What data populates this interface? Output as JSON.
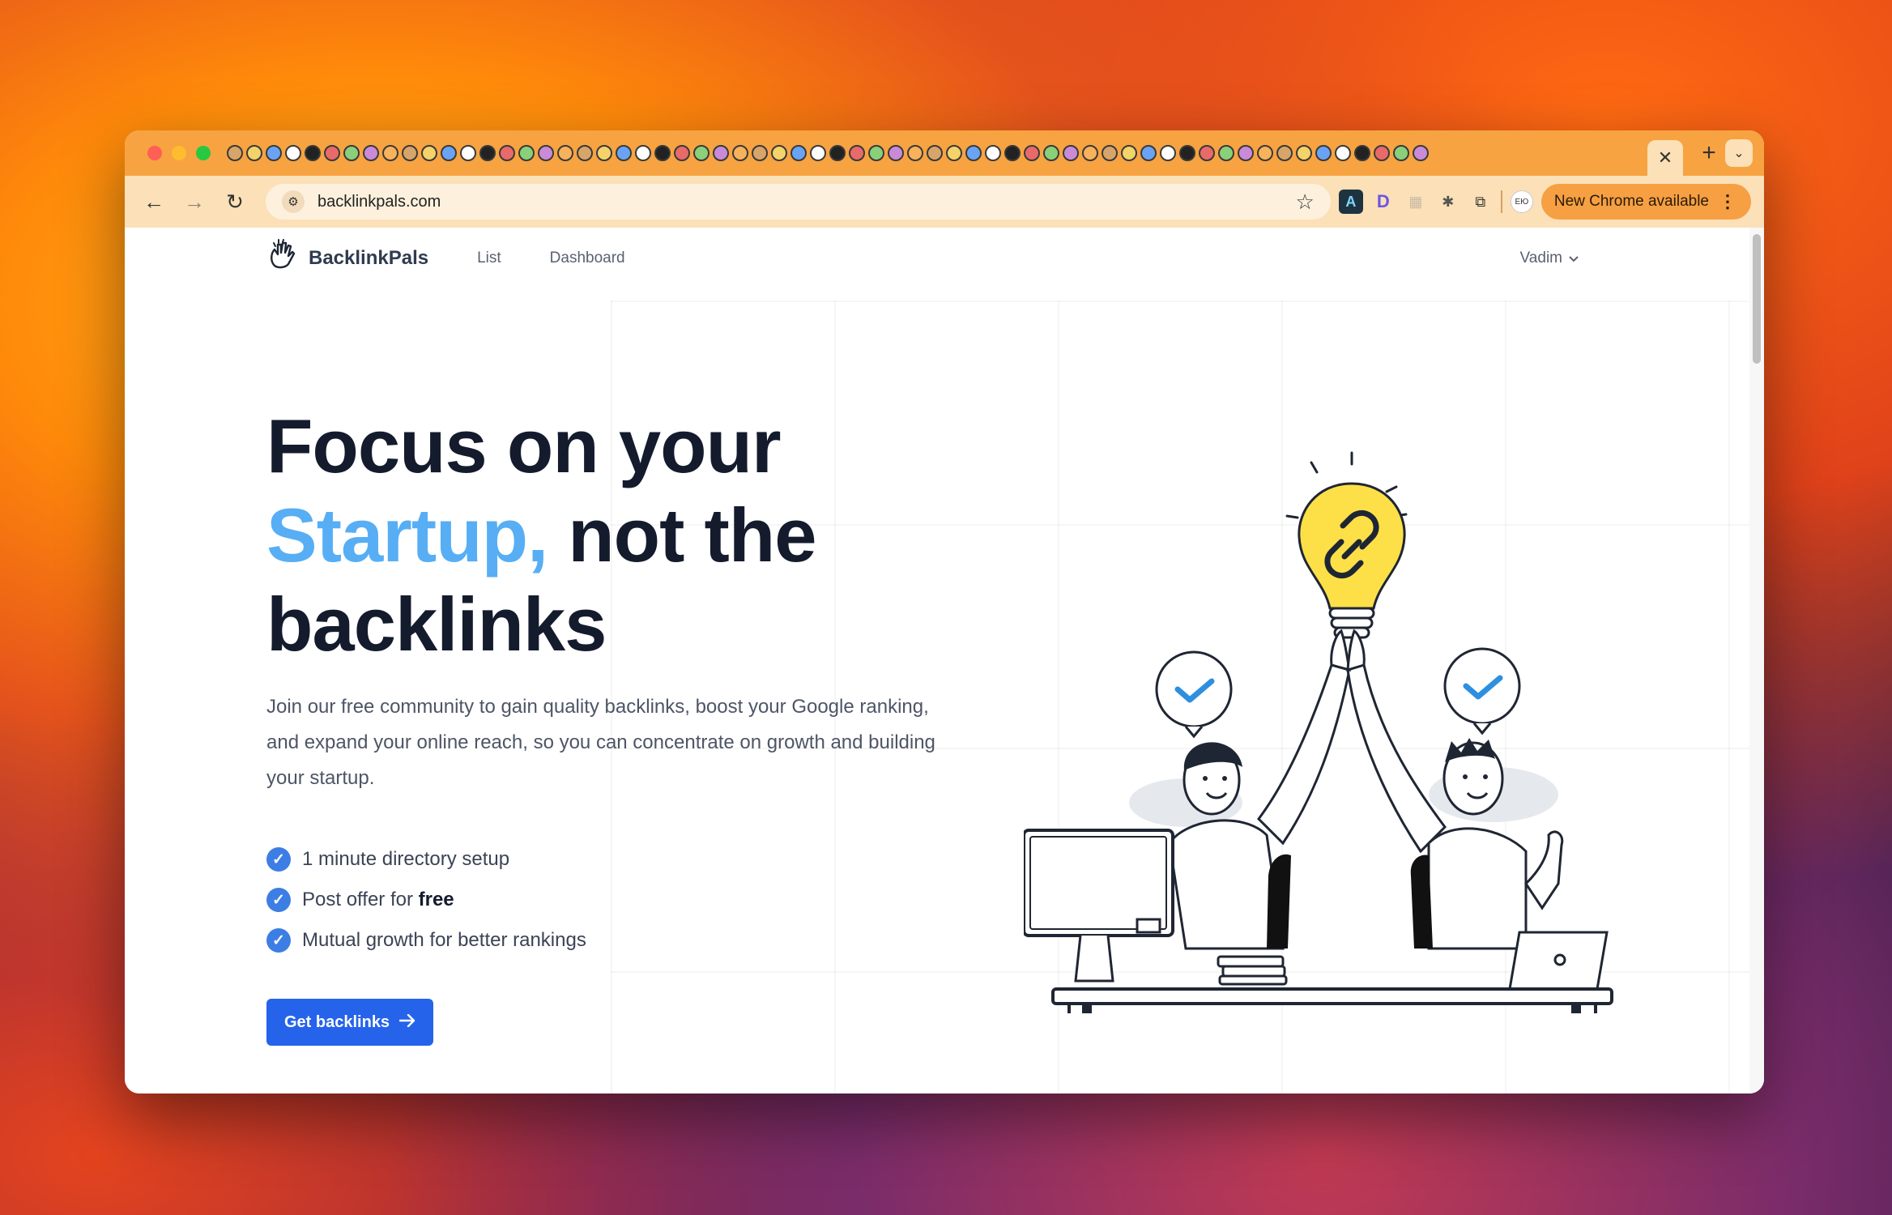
{
  "browser": {
    "active_tab_close": "✕",
    "new_tab": "+",
    "tab_menu": "⌄",
    "url": "backlinkpals.com",
    "update_label": "New Chrome available",
    "profile_label": "ЕЮ"
  },
  "site": {
    "brand": "BacklinkPals",
    "nav": {
      "list": "List",
      "dashboard": "Dashboard"
    },
    "user": "Vadim"
  },
  "hero": {
    "title_line1": "Focus on your",
    "title_highlight": "Startup,",
    "title_line2_rest": " not the",
    "title_line3": "backlinks",
    "description": "Join our free community to gain quality backlinks, boost your Google ranking, and expand your online reach, so you can concentrate on growth and building your startup.",
    "features": [
      {
        "text": "1 minute directory setup"
      },
      {
        "text_before": "Post offer for ",
        "text_bold": "free"
      },
      {
        "text": "Mutual growth for better rankings"
      }
    ],
    "cta_label": "Get backlinks"
  },
  "icons": {
    "feature_check": "check-circle-icon",
    "cta_arrow": "arrow-right-icon",
    "user_chevron": "chevron-down-icon"
  },
  "colors": {
    "tabstrip": "#f7a341",
    "toolbar": "#fbe0b8",
    "highlight": "#57aef4",
    "cta": "#2563eb",
    "check": "#3d7ee4",
    "bulb": "#fde047"
  }
}
